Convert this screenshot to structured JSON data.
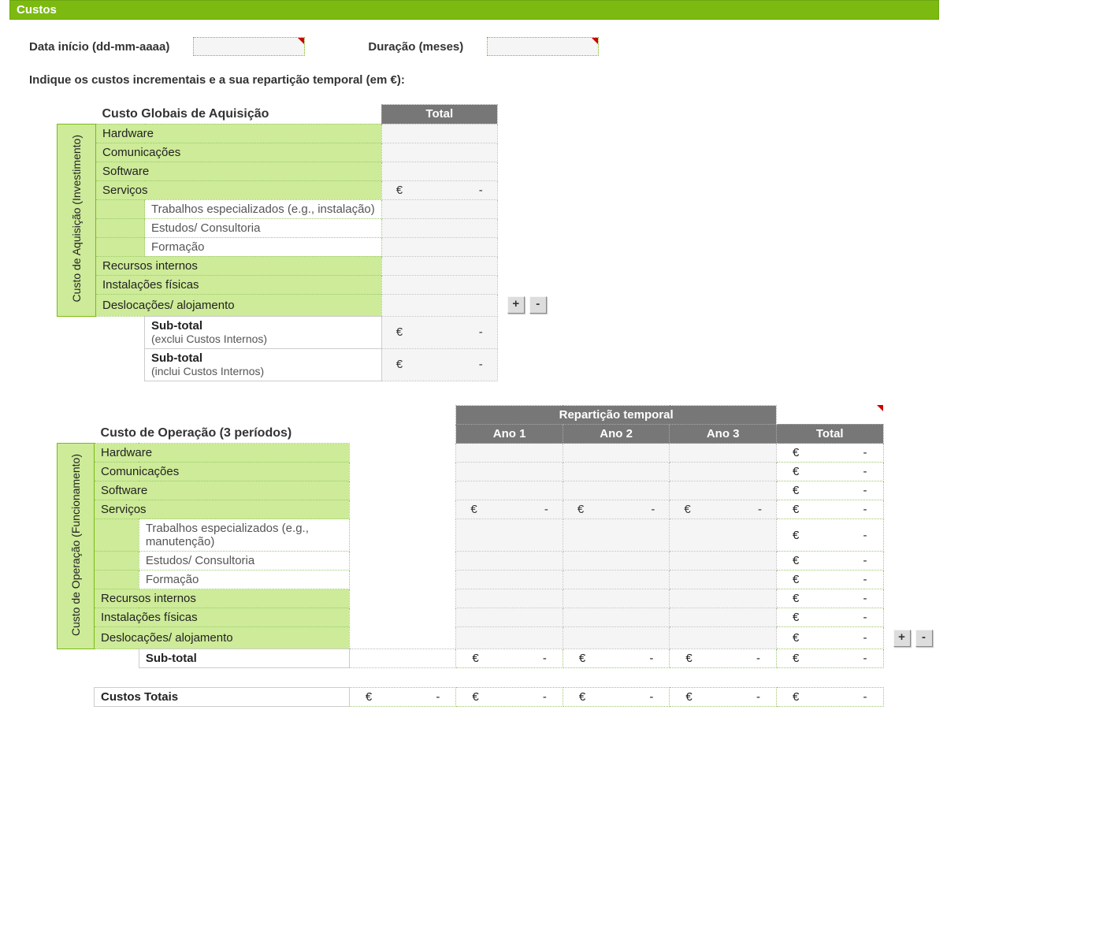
{
  "banner": {
    "title": "Custos"
  },
  "form": {
    "date_label": "Data início (dd-mm-aaaa)",
    "date_value": "",
    "duration_label": "Duração (meses)",
    "duration_value": ""
  },
  "instruction": "Indique os custos incrementais e a sua repartição temporal (em €):",
  "buttons": {
    "plus": "+",
    "minus": "-"
  },
  "money": {
    "euro": "€",
    "dash": "-"
  },
  "acquisition": {
    "title": "Custo Globais de Aquisição",
    "vlabel": "Custo de Aquisição (Investimento)",
    "total_header": "Total",
    "rows": {
      "hardware": "Hardware",
      "comunicacoes": "Comunicações",
      "software": "Software",
      "servicos": "Serviços",
      "sub_trabalhos": "Trabalhos especializados (e.g., instalação)",
      "sub_estudos": "Estudos/ Consultoria",
      "sub_formacao": "Formação",
      "recursos": "Recursos internos",
      "instalacoes": "Instalações físicas",
      "deslocacoes": "Deslocações/ alojamento"
    },
    "subtotal_exclui": {
      "label": "Sub-total",
      "note": "(exclui Custos Internos)"
    },
    "subtotal_inclui": {
      "label": "Sub-total",
      "note": "(inclui Custos Internos)"
    }
  },
  "operation": {
    "title": "Custo de Operação (3 períodos)",
    "vlabel": "Custo de Operação (Funcionamento)",
    "repart_header": "Repartição temporal",
    "year_headers": [
      "Ano 1",
      "Ano 2",
      "Ano 3"
    ],
    "total_header": "Total",
    "rows": {
      "hardware": "Hardware",
      "comunicacoes": "Comunicações",
      "software": "Software",
      "servicos": "Serviços",
      "sub_trabalhos": "Trabalhos especializados (e.g., manutenção)",
      "sub_estudos": "Estudos/ Consultoria",
      "sub_formacao": "Formação",
      "recursos": "Recursos internos",
      "instalacoes": "Instalações físicas",
      "deslocacoes": "Deslocações/ alojamento"
    },
    "subtotal": "Sub-total"
  },
  "totals": {
    "label": "Custos Totais"
  }
}
